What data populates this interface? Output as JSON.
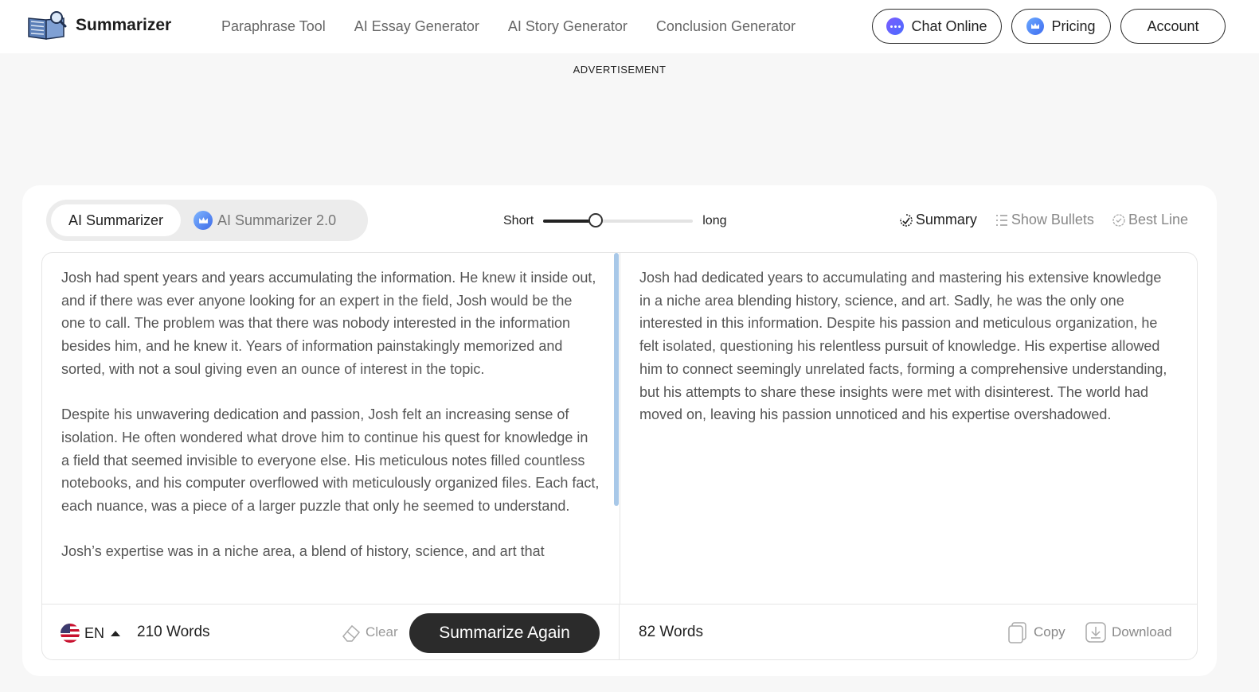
{
  "header": {
    "brand": "Summarizer",
    "nav": [
      "Paraphrase Tool",
      "AI Essay Generator",
      "AI Story Generator",
      "Conclusion Generator"
    ],
    "chat_label": "Chat Online",
    "pricing_label": "Pricing",
    "account_label": "Account"
  },
  "ad": {
    "label": "ADVERTISEMENT"
  },
  "modes": {
    "primary": "AI Summarizer",
    "secondary": "AI Summarizer 2.0"
  },
  "length": {
    "short_label": "Short",
    "long_label": "long",
    "value": 0.35
  },
  "views": {
    "summary": "Summary",
    "bullets": "Show Bullets",
    "best_line": "Best Line"
  },
  "input": {
    "paragraphs": [
      "Josh had spent years and years accumulating the information. He knew it inside out, and if there was ever anyone looking for an expert in the field, Josh would be the one to call. The problem was that there was nobody interested in the information besides him, and he knew it. Years of information painstakingly memorized and sorted, with not a soul giving even an ounce of interest in the topic.",
      "Despite his unwavering dedication and passion, Josh felt an increasing sense of isolation. He often wondered what drove him to continue his quest for knowledge in a field that seemed invisible to everyone else. His meticulous notes filled countless notebooks, and his computer overflowed with meticulously organized files. Each fact, each nuance, was a piece of a larger puzzle that only he seemed to understand.",
      "Josh’s expertise was in a niche area, a blend of history, science, and art that"
    ],
    "language": "EN",
    "word_count": "210 Words",
    "clear_label": "Clear",
    "action_label": "Summarize Again"
  },
  "output": {
    "text": "Josh had dedicated years to accumulating and mastering his extensive knowledge in a niche area blending history, science, and art. Sadly, he was the only one interested in this information. Despite his passion and meticulous organization, he felt isolated, questioning his relentless pursuit of knowledge. His expertise allowed him to connect seemingly unrelated facts, forming a comprehensive understanding, but his attempts to share these insights were met with disinterest. The world had moved on, leaving his passion unnoticed and his expertise overshadowed.",
    "word_count": "82 Words",
    "copy_label": "Copy",
    "download_label": "Download"
  }
}
